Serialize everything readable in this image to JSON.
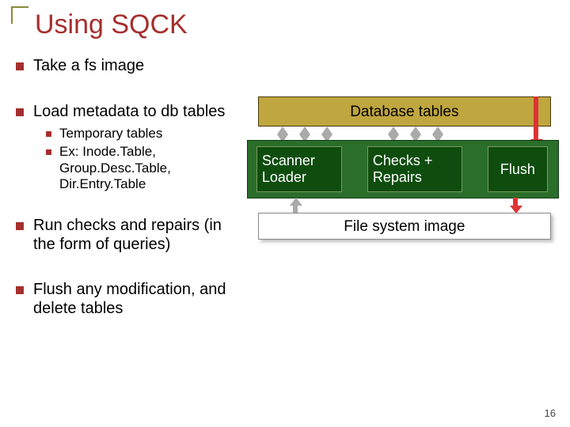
{
  "title": "Using SQCK",
  "bullets": {
    "b1": "Take a fs image",
    "b2": "Load metadata to db tables",
    "b2_sub1": "Temporary tables",
    "b2_sub2": "Ex: Inode.Table, Group.Desc.Table, Dir.Entry.Table",
    "b3": "Run checks and repairs (in the form of queries)",
    "b4": "Flush any modification, and delete tables"
  },
  "diagram": {
    "db_tables": "Database tables",
    "scanner": "Scanner Loader",
    "checks": "Checks + Repairs",
    "flush": "Flush",
    "fs_image": "File system image"
  },
  "page_number": "16"
}
